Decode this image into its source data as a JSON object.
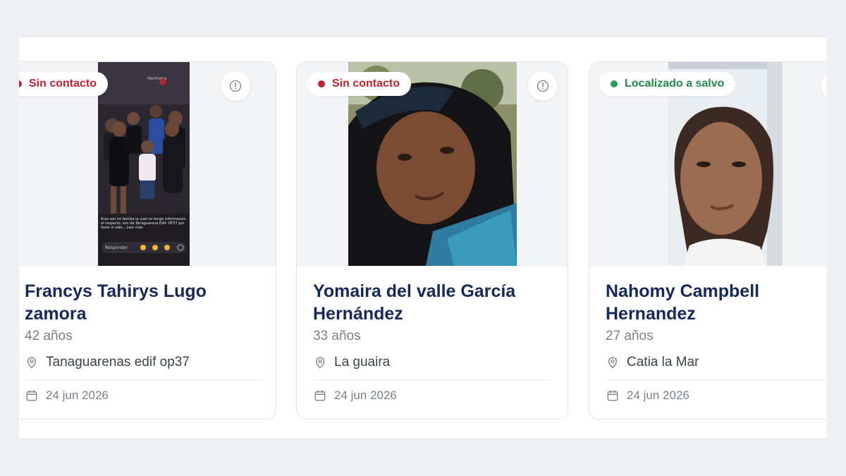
{
  "cards": [
    {
      "status": "Sin contacto",
      "status_color": "#c0222f",
      "name": "Francys Tahirys Lugo zamora",
      "age": "42 años",
      "location": "Tanaguarenas edif op37",
      "date": "24 jun 2026",
      "photo_overlay_text": "Esta son mi familia la cual no tengo información al respecto, son de Tanaguarena Edif. OP37 por favor si sabi... Leer más",
      "photo_reply_label": "Responder",
      "photo_header": "Hermana"
    },
    {
      "status": "Sin contacto",
      "status_color": "#c0222f",
      "name": "Yomaira del valle García Hernández",
      "age": "33 años",
      "location": "La guaira",
      "date": "24 jun 2026"
    },
    {
      "status": "Localizado a salvo",
      "status_color": "#218a4a",
      "name": "Nahomy Campbell Hernandez",
      "age": "27 años",
      "location": "Catia la Mar",
      "date": "24 jun 2026"
    }
  ],
  "icons": {
    "info": "info-circle-icon",
    "location": "map-pin-icon",
    "date": "calendar-icon"
  }
}
